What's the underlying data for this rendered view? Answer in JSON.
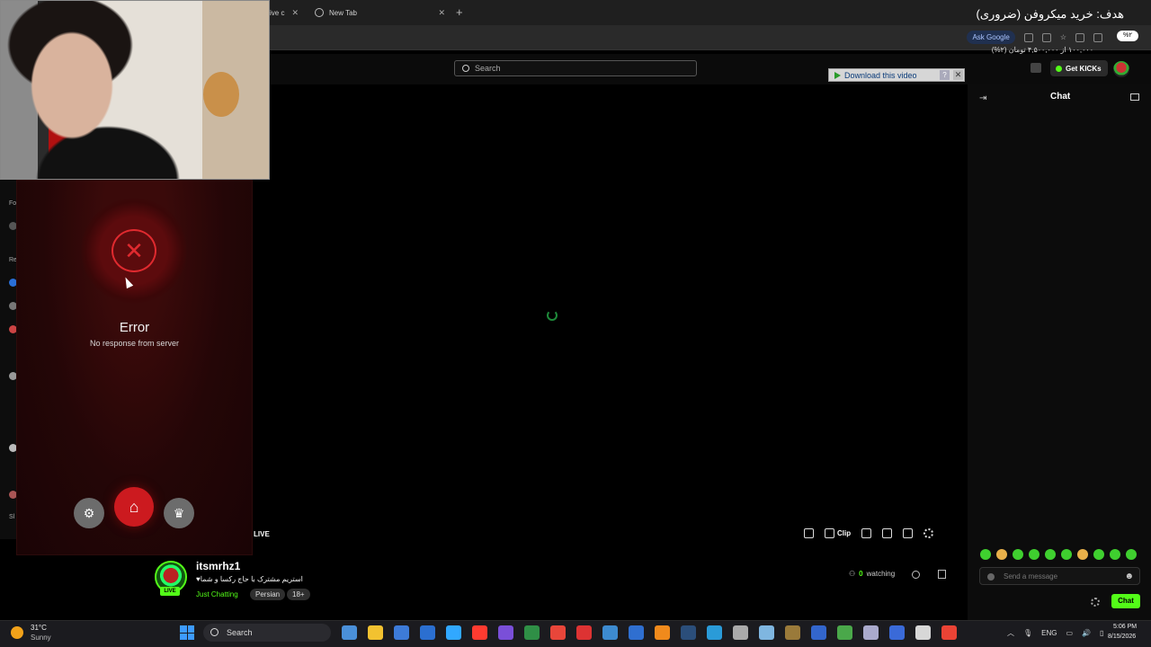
{
  "browser": {
    "tabs": [
      {
        "label": "ive c"
      },
      {
        "label": "New Tab"
      }
    ],
    "ask_google": "Ask Google"
  },
  "goal": {
    "title": "هدف: خرید میکروفن (ضروری)",
    "progress_text": "۱۰۰,۰۰۰ از ۴,۵۰۰,۰۰۰ تومان (۲%)",
    "percent_badge": "%۲"
  },
  "site": {
    "search_placeholder": "Search",
    "download_label": "Download this video",
    "download_help": "?",
    "download_close": "✕",
    "get_kicks": "Get KICKs"
  },
  "player": {
    "live_label": "LIVE",
    "clip_label": "Clip"
  },
  "stream": {
    "streamer": "itsmrhz1",
    "title": "استریم مشترک با حاج رکسا و شما♥",
    "category": "Just Chatting",
    "tags": [
      "Persian",
      "18+"
    ],
    "viewers": "0",
    "watching_label": "watching",
    "live_badge": "LIVE"
  },
  "chat": {
    "title": "Chat",
    "input_placeholder": "Send a message",
    "send_label": "Chat",
    "collapse_icon": "⇥"
  },
  "error_dialog": {
    "title": "Error",
    "message": "No response from server",
    "close_glyph": "✕",
    "home_glyph": "⌂",
    "settings_glyph": "⚙",
    "crown_glyph": "♛"
  },
  "sidebar": {
    "labels": [
      "Fo",
      "Re",
      "Sl"
    ]
  },
  "taskbar": {
    "weather_temp": "31°C",
    "weather_desc": "Sunny",
    "search_label": "Search",
    "language": "ENG",
    "time": "5:06 PM",
    "date": "8/15/2026",
    "app_colors": [
      "#4a90d9",
      "#f2c230",
      "#3d7bd8",
      "#2b6fd0",
      "#31a8ff",
      "#ff3b30",
      "#7a4fd8",
      "#2f8f46",
      "#e8463a",
      "#d33",
      "#3d8bd0",
      "#2f6fd0",
      "#f08a1c",
      "#2b4e7a",
      "#2a9bd8",
      "#aaa",
      "#7fb6e0",
      "#9a7a3a",
      "#3366cc",
      "#4aa84a",
      "#aac",
      "#3a6ad8",
      "#d7d7d7",
      "#ea4335"
    ]
  },
  "colors": {
    "kick_green": "#53fc18",
    "error_red": "#e02a2f",
    "home_red": "#cc1a1f"
  }
}
